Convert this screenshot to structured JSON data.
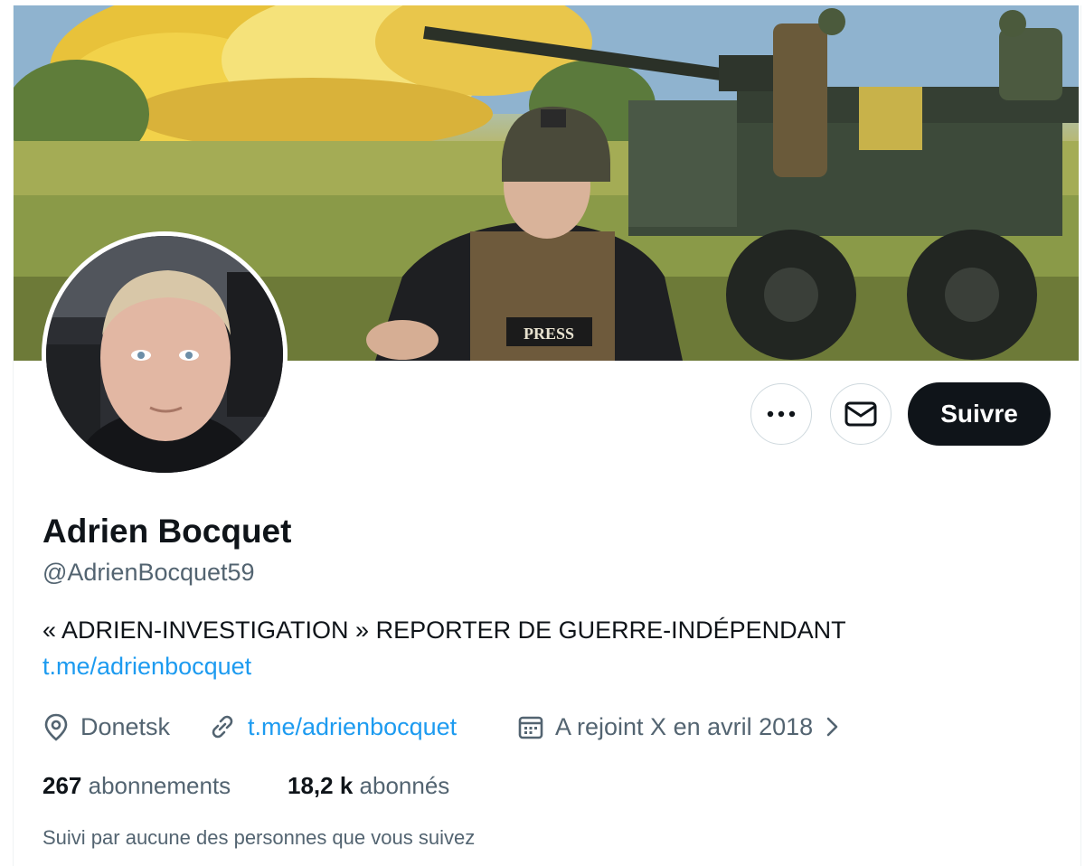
{
  "profile": {
    "name": "Adrien Bocquet",
    "handle": "@AdrienBocquet59",
    "bio": "« ADRIEN-INVESTIGATION » REPORTER DE GUERRE-INDÉPENDANT",
    "bio_link": "t.me/adrienbocquet",
    "location": "Donetsk",
    "website": "t.me/adrienbocquet",
    "joined": "A rejoint X en avril 2018",
    "following_count": "267",
    "following_label": "abonnements",
    "followers_count": "18,2 k",
    "followers_label": "abonnés",
    "followed_by": "Suivi par aucune des personnes que vous suivez"
  },
  "actions": {
    "more_icon": "more-icon",
    "message_icon": "envelope-icon",
    "follow_label": "Suivre"
  },
  "banner": {
    "press_label": "PRESS"
  },
  "colors": {
    "accent": "#1d9bf0",
    "primary_text": "#0f1419",
    "secondary_text": "#536471",
    "button_dark": "#0f1419"
  }
}
